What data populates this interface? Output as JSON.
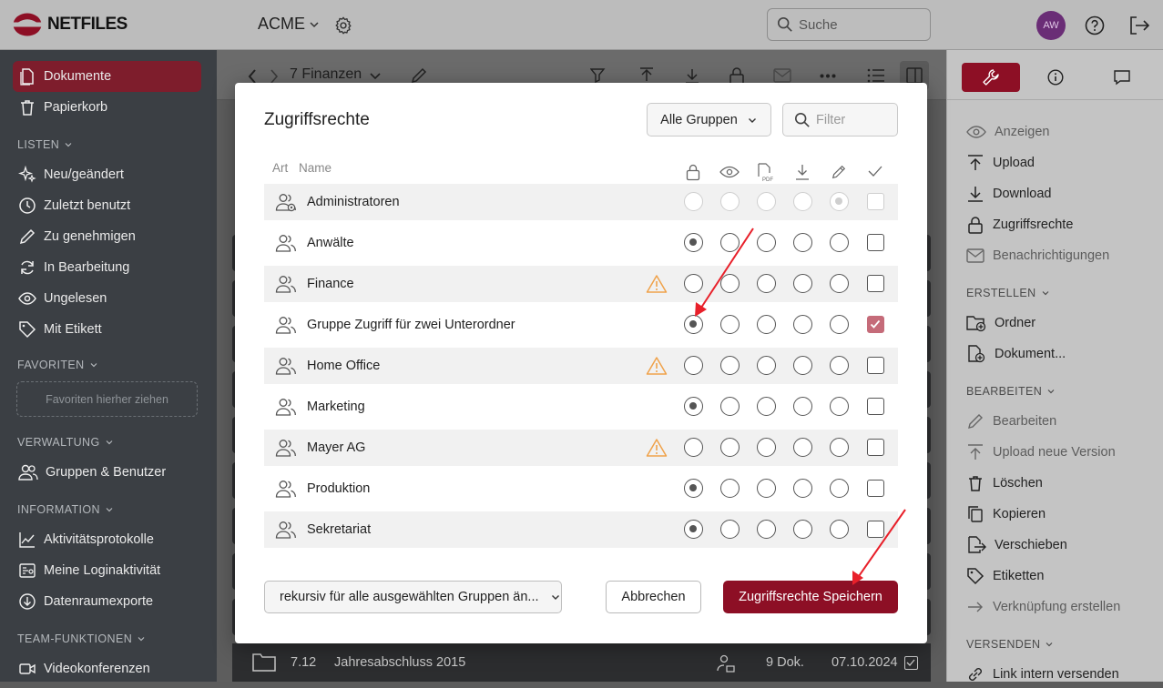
{
  "topbar": {
    "logo": "NETFILES",
    "company": "ACME",
    "search_placeholder": "Suche",
    "avatar": "AW"
  },
  "sidebar": {
    "items": [
      {
        "label": "Dokumente",
        "icon": "document-icon",
        "active": true
      },
      {
        "label": "Papierkorb",
        "icon": "trash-icon"
      }
    ],
    "sections": {
      "listen": "LISTEN",
      "favoriten": "FAVORITEN",
      "verwaltung": "VERWALTUNG",
      "information": "INFORMATION",
      "team": "TEAM-FUNKTIONEN"
    },
    "listen_items": [
      {
        "label": "Neu/geändert",
        "icon": "sparkle-icon"
      },
      {
        "label": "Zuletzt benutzt",
        "icon": "clock-icon"
      },
      {
        "label": "Zu genehmigen",
        "icon": "pencil-icon"
      },
      {
        "label": "In Bearbeitung",
        "icon": "refresh-icon"
      },
      {
        "label": "Ungelesen",
        "icon": "eye-icon"
      },
      {
        "label": "Mit Etikett",
        "icon": "tag-icon"
      }
    ],
    "favorites_drop": "Favoriten hierher ziehen",
    "verwaltung_items": [
      {
        "label": "Gruppen & Benutzer",
        "icon": "users-icon"
      }
    ],
    "information_items": [
      {
        "label": "Aktivitätsprotokolle",
        "icon": "activity-icon"
      },
      {
        "label": "Meine Loginaktivität",
        "icon": "login-activity-icon"
      },
      {
        "label": "Datenraumexporte",
        "icon": "export-icon"
      }
    ],
    "team_items": [
      {
        "label": "Videokonferenzen",
        "icon": "video-icon"
      }
    ]
  },
  "center": {
    "breadcrumb": "7 Finanzen",
    "bottom_row": {
      "number": "7.12",
      "name": "Jahresabschluss 2015",
      "count": "9 Dok.",
      "date": "07.10.2024"
    }
  },
  "right_panel": {
    "actions": [
      {
        "label": "Anzeigen",
        "icon": "eye-icon",
        "enabled": false
      },
      {
        "label": "Upload",
        "icon": "upload-icon",
        "enabled": true
      },
      {
        "label": "Download",
        "icon": "download-icon",
        "enabled": true
      },
      {
        "label": "Zugriffsrechte",
        "icon": "lock-icon",
        "enabled": true
      },
      {
        "label": "Benachrichtigungen",
        "icon": "mail-icon",
        "enabled": false
      }
    ],
    "sections": {
      "erstellen": "ERSTELLEN",
      "bearbeiten": "BEARBEITEN",
      "versenden": "VERSENDEN"
    },
    "erstellen": [
      {
        "label": "Ordner",
        "icon": "folder-plus-icon",
        "enabled": true
      },
      {
        "label": "Dokument...",
        "icon": "document-plus-icon",
        "enabled": true
      }
    ],
    "bearbeiten": [
      {
        "label": "Bearbeiten",
        "icon": "pencil-icon",
        "enabled": false
      },
      {
        "label": "Upload neue Version",
        "icon": "upload-icon",
        "enabled": false
      },
      {
        "label": "Löschen",
        "icon": "trash-icon",
        "enabled": true
      },
      {
        "label": "Kopieren",
        "icon": "copy-icon",
        "enabled": true
      },
      {
        "label": "Verschieben",
        "icon": "move-icon",
        "enabled": true
      },
      {
        "label": "Etiketten",
        "icon": "tag-icon",
        "enabled": true
      },
      {
        "label": "Verknüpfung erstellen",
        "icon": "arrow-right-icon",
        "enabled": false
      }
    ],
    "versenden": [
      {
        "label": "Link intern versenden",
        "icon": "link-icon",
        "enabled": true
      }
    ]
  },
  "modal": {
    "title": "Zugriffsrechte",
    "group_filter": "Alle Gruppen",
    "filter_placeholder": "Filter",
    "columns": {
      "art": "Art",
      "name": "Name"
    },
    "permission_columns": [
      "lock-icon",
      "eye-icon",
      "pdf-icon",
      "download-icon",
      "pencil-icon",
      "check-icon"
    ],
    "rows": [
      {
        "name": "Administratoren",
        "selected": 4,
        "checked": false,
        "disabled": true,
        "warning": false
      },
      {
        "name": "Anwälte",
        "selected": 0,
        "checked": false,
        "disabled": false,
        "warning": false
      },
      {
        "name": "Finance",
        "selected": -1,
        "checked": false,
        "disabled": false,
        "warning": true
      },
      {
        "name": "Gruppe Zugriff für zwei Unterordner",
        "selected": 0,
        "checked": true,
        "disabled": false,
        "warning": false
      },
      {
        "name": "Home Office",
        "selected": -1,
        "checked": false,
        "disabled": false,
        "warning": true
      },
      {
        "name": "Marketing",
        "selected": 0,
        "checked": false,
        "disabled": false,
        "warning": false
      },
      {
        "name": "Mayer AG",
        "selected": -1,
        "checked": false,
        "disabled": false,
        "warning": true
      },
      {
        "name": "Produktion",
        "selected": 0,
        "checked": false,
        "disabled": false,
        "warning": false
      },
      {
        "name": "Sekretariat",
        "selected": 0,
        "checked": false,
        "disabled": false,
        "warning": false
      }
    ],
    "recursive_label": "rekursiv für alle ausgewählten Gruppen än...",
    "cancel_label": "Abbrechen",
    "save_label": "Zugriffsrechte Speichern"
  },
  "colors": {
    "brand": "#8d0f25",
    "sidebar_bg": "#3b3f44",
    "active_item": "#7e1d2c",
    "checkbox_checked": "#c56b79",
    "warning": "#f0a24a",
    "annotation_arrow": "#e8202a"
  }
}
